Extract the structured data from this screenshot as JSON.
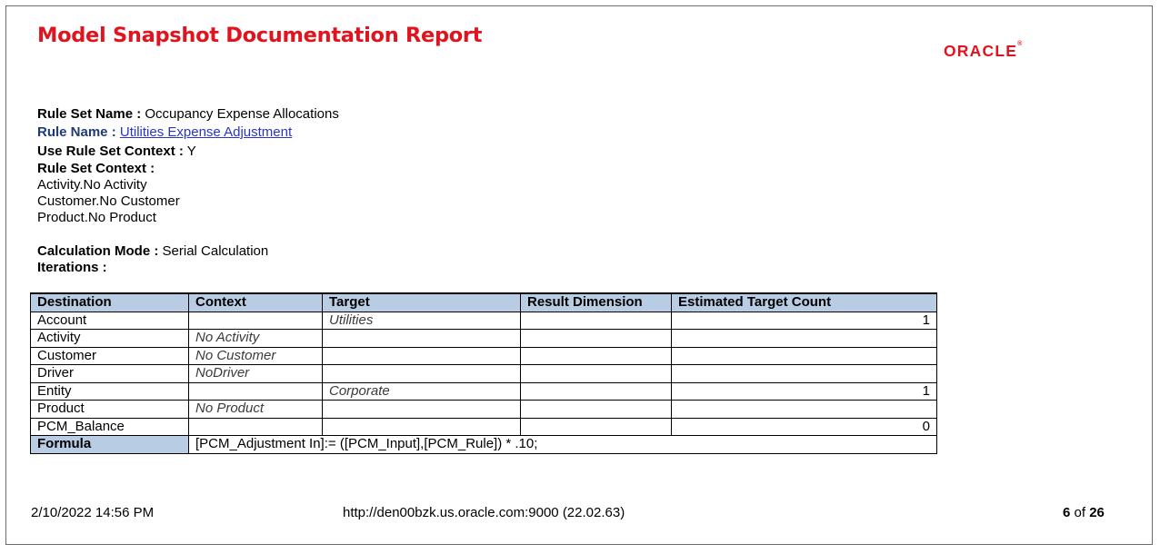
{
  "header": {
    "title": "Model Snapshot Documentation Report",
    "logo_text": "ORACLE",
    "logo_mark": "®"
  },
  "rule_info": {
    "rule_set_name_label": "Rule Set Name :",
    "rule_set_name_value": "Occupancy Expense Allocations",
    "rule_name_label": "Rule Name :",
    "rule_name_value": "Utilities Expense Adjustment",
    "use_context_label": "Use Rule Set Context :",
    "use_context_value": "Y",
    "context_label": "Rule Set Context :",
    "context_items": [
      "Activity.No Activity",
      "Customer.No Customer",
      "Product.No Product"
    ],
    "calc_mode_label": "Calculation Mode :",
    "calc_mode_value": "Serial Calculation",
    "iterations_label": "Iterations :",
    "iterations_value": ""
  },
  "table": {
    "headers": [
      "Destination",
      "Context",
      "Target",
      "Result Dimension",
      "Estimated Target Count"
    ],
    "rows": [
      {
        "destination": "Account",
        "context": "",
        "target": "Utilities",
        "result": "",
        "count": "1"
      },
      {
        "destination": "Activity",
        "context": "No Activity",
        "target": "",
        "result": "",
        "count": ""
      },
      {
        "destination": "Customer",
        "context": "No Customer",
        "target": "",
        "result": "",
        "count": ""
      },
      {
        "destination": "Driver",
        "context": "NoDriver",
        "target": "",
        "result": "",
        "count": ""
      },
      {
        "destination": "Entity",
        "context": "",
        "target": "Corporate",
        "result": "",
        "count": "1"
      },
      {
        "destination": "Product",
        "context": "No Product",
        "target": "",
        "result": "",
        "count": ""
      },
      {
        "destination": "PCM_Balance",
        "context": "",
        "target": "",
        "result": "",
        "count": "0"
      }
    ],
    "formula_label": "Formula",
    "formula_value": "[PCM_Adjustment In]:= ([PCM_Input],[PCM_Rule]) * .10;"
  },
  "footer": {
    "timestamp": "2/10/2022 14:56 PM",
    "url": "http://den00bzk.us.oracle.com:9000 (22.02.63)",
    "page_current": "6",
    "page_of": " of ",
    "page_total": "26"
  },
  "colors": {
    "title": "#e0141e",
    "table_header": "#b8cce4",
    "link": "#2a35c6"
  }
}
